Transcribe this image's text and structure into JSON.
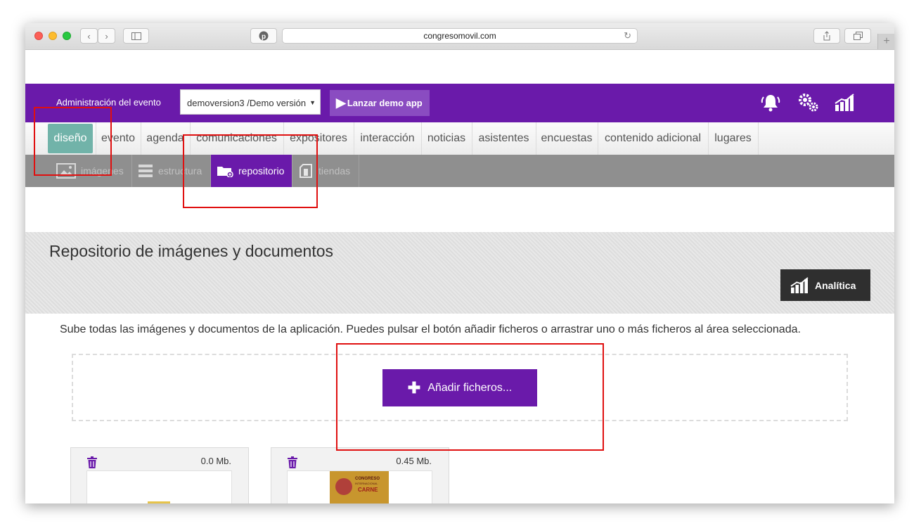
{
  "browser": {
    "url": "congresomovil.com"
  },
  "header": {
    "admin_label": "Administración del evento",
    "event_select_value": "demoversion3 /Demo versión",
    "launch_button": "Lanzar demo app",
    "brand_color": "#6a1aaa"
  },
  "main_nav": {
    "items": [
      {
        "label": "diseño",
        "active": true
      },
      {
        "label": "evento"
      },
      {
        "label": "agenda"
      },
      {
        "label": "comunicaciones"
      },
      {
        "label": "expositores"
      },
      {
        "label": "interacción"
      },
      {
        "label": "noticias"
      },
      {
        "label": "asistentes"
      },
      {
        "label": "encuestas"
      },
      {
        "label": "contenido adicional"
      },
      {
        "label": "lugares"
      }
    ]
  },
  "sub_nav": {
    "items": [
      {
        "label": "imágenes",
        "icon": "image-icon"
      },
      {
        "label": "estructura",
        "icon": "stack-icon"
      },
      {
        "label": "repositorio",
        "icon": "folder-add-icon",
        "active": true
      },
      {
        "label": "tiendas",
        "icon": "store-icon"
      }
    ]
  },
  "page": {
    "title": "Repositorio de imágenes y documentos",
    "analytics_button": "Analítica",
    "instructions": "Sube todas las imágenes y documentos de la aplicación. Puedes pulsar el botón añadir ficheros o arrastrar uno o más ficheros al área seleccionada.",
    "add_button": "Añadir ficheros..."
  },
  "files": [
    {
      "size": "0.0 Mb."
    },
    {
      "size": "0.45 Mb.",
      "thumb_lines": [
        "CONGRESO",
        "INTERNACIONAL",
        "CARNE"
      ]
    }
  ]
}
